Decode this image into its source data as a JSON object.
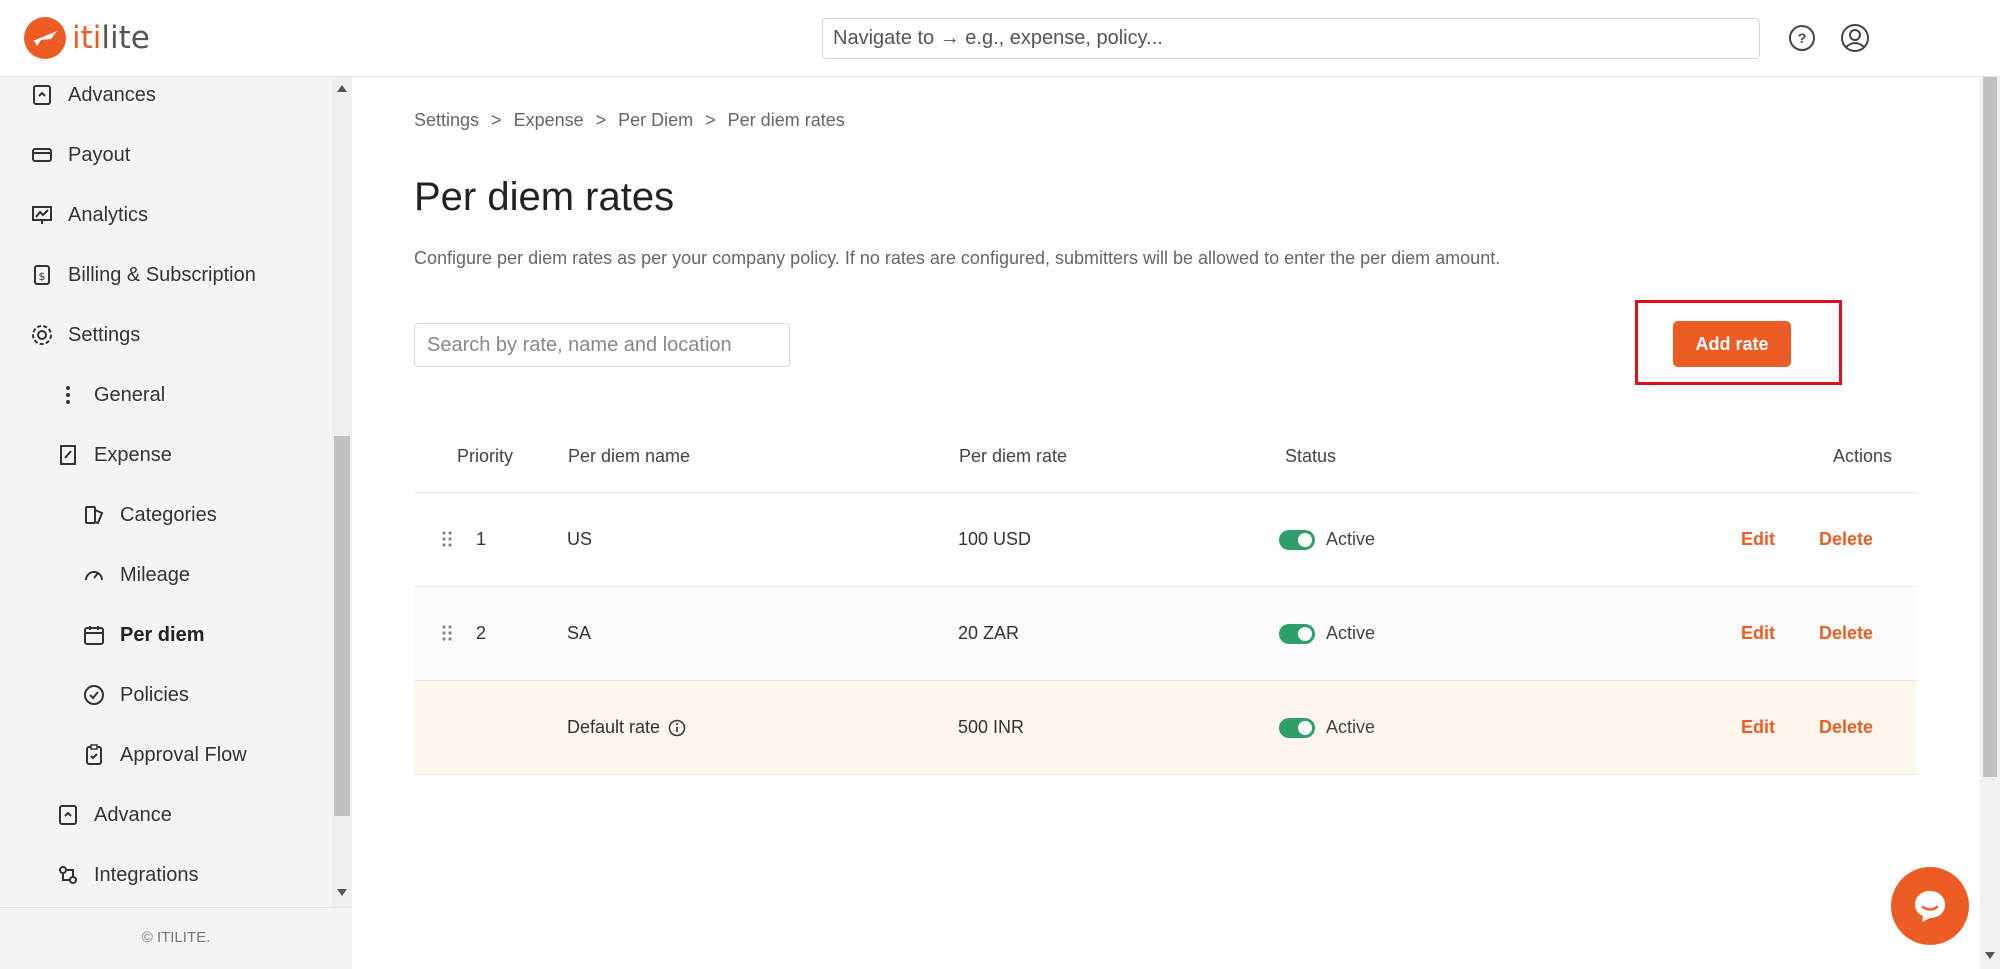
{
  "header": {
    "logo_iti": "iti",
    "logo_lite": "lite",
    "nav_placeholder": "Navigate to → e.g., expense, policy..."
  },
  "sidebar": {
    "items": [
      {
        "label": "Advances",
        "icon": "advances-icon"
      },
      {
        "label": "Payout",
        "icon": "payout-icon"
      },
      {
        "label": "Analytics",
        "icon": "analytics-icon"
      },
      {
        "label": "Billing & Subscription",
        "icon": "billing-icon"
      },
      {
        "label": "Settings",
        "icon": "gear-icon"
      },
      {
        "label": "General",
        "icon": "kebab-icon"
      },
      {
        "label": "Expense",
        "icon": "expense-icon"
      },
      {
        "label": "Categories",
        "icon": "categories-icon"
      },
      {
        "label": "Mileage",
        "icon": "mileage-icon"
      },
      {
        "label": "Per diem",
        "icon": "calendar-icon",
        "active": true
      },
      {
        "label": "Policies",
        "icon": "policies-icon"
      },
      {
        "label": "Approval Flow",
        "icon": "clipboard-icon"
      },
      {
        "label": "Advance",
        "icon": "advance-icon"
      },
      {
        "label": "Integrations",
        "icon": "integrations-icon"
      }
    ],
    "footer": "© ITILITE."
  },
  "breadcrumb": [
    "Settings",
    ">",
    "Expense",
    ">",
    "Per Diem",
    ">",
    "Per diem rates"
  ],
  "page": {
    "title": "Per diem rates",
    "description": "Configure per diem rates as per your company policy. If no rates are configured, submitters will be allowed to enter the per diem amount.",
    "search_placeholder": "Search by rate, name and location",
    "add_button": "Add rate"
  },
  "table": {
    "headers": {
      "priority": "Priority",
      "name": "Per diem name",
      "rate": "Per diem rate",
      "status": "Status",
      "actions": "Actions"
    },
    "rows": [
      {
        "priority": "1",
        "name": "US",
        "rate": "100 USD",
        "status": "Active",
        "edit": "Edit",
        "delete": "Delete"
      },
      {
        "priority": "2",
        "name": "SA",
        "rate": "20 ZAR",
        "status": "Active",
        "edit": "Edit",
        "delete": "Delete"
      },
      {
        "priority": "",
        "name": "Default rate",
        "rate": "500 INR",
        "status": "Active",
        "edit": "Edit",
        "delete": "Delete"
      }
    ]
  },
  "colors": {
    "brand": "#ee5c26",
    "active_toggle": "#2e9e6a",
    "highlight": "#e0101a"
  }
}
